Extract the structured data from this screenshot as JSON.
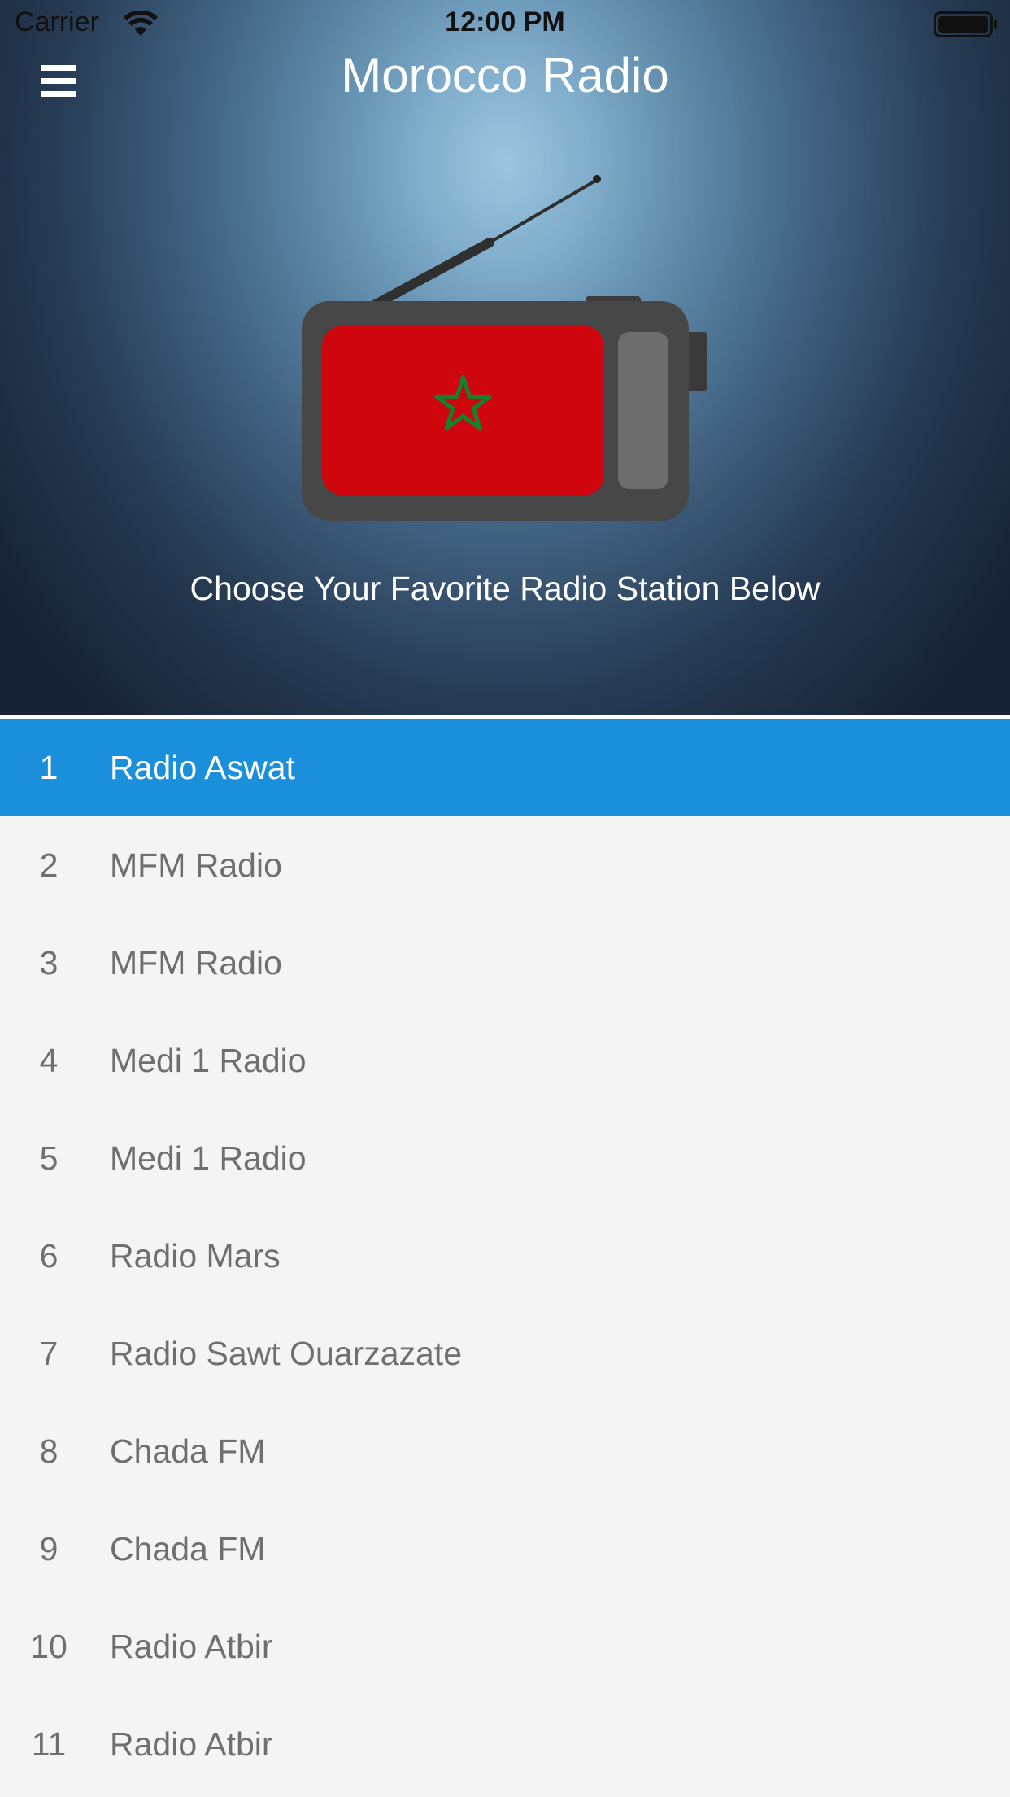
{
  "status_bar": {
    "carrier": "Carrier",
    "time": "12:00 PM",
    "wifi_icon": "wifi-icon",
    "battery_icon": "battery-full-icon"
  },
  "header": {
    "title": "Morocco Radio",
    "menu_icon": "hamburger-menu-icon"
  },
  "hero": {
    "subtitle": "Choose Your Favorite Radio Station Below",
    "illustration": "radio-with-morocco-flag",
    "flag_colors": {
      "red": "#d0060e",
      "star": "#16812c"
    }
  },
  "colors": {
    "accent": "#1a8fdc",
    "list_background": "#f4f4f4",
    "list_text": "#6f6f6f"
  },
  "stations": [
    {
      "number": "1",
      "name": "Radio Aswat",
      "selected": true
    },
    {
      "number": "2",
      "name": "MFM Radio"
    },
    {
      "number": "3",
      "name": "MFM Radio"
    },
    {
      "number": "4",
      "name": "Medi 1 Radio"
    },
    {
      "number": "5",
      "name": "Medi 1 Radio"
    },
    {
      "number": "6",
      "name": "Radio Mars"
    },
    {
      "number": "7",
      "name": "Radio Sawt Ouarzazate"
    },
    {
      "number": "8",
      "name": "Chada FM"
    },
    {
      "number": "9",
      "name": "Chada FM"
    },
    {
      "number": "10",
      "name": "Radio Atbir"
    },
    {
      "number": "11",
      "name": "Radio Atbir"
    }
  ]
}
